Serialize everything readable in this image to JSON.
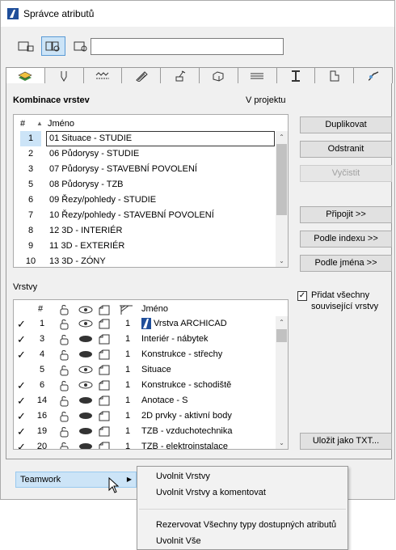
{
  "window": {
    "title": "Správce atributů"
  },
  "search": {
    "value": ""
  },
  "toolbar": {
    "buttons": [
      "view-list-icon",
      "view-split-icon",
      "view-detail-icon"
    ]
  },
  "tabs": [
    "layers-icon",
    "pen-icon",
    "line-type-icon",
    "fill-icon",
    "building-material-icon",
    "composite-icon",
    "surface-icon",
    "profile-icon",
    "zone-icon",
    "mep-icon"
  ],
  "combos": {
    "title": "Kombinace vrstev",
    "right_label": "V projektu",
    "col_num": "#",
    "col_name": "Jméno",
    "rows": [
      {
        "num": "1",
        "name": "01 Situace - STUDIE"
      },
      {
        "num": "2",
        "name": "06 Půdorysy - STUDIE"
      },
      {
        "num": "3",
        "name": "07 Půdorysy - STAVEBNÍ POVOLENÍ"
      },
      {
        "num": "5",
        "name": "08 Půdorysy - TZB"
      },
      {
        "num": "6",
        "name": "09 Řezy/pohledy - STUDIE"
      },
      {
        "num": "7",
        "name": "10 Řezy/pohledy - STAVEBNÍ POVOLENÍ"
      },
      {
        "num": "8",
        "name": "12 3D - INTERIÉR"
      },
      {
        "num": "9",
        "name": "11 3D - EXTERIÉR"
      },
      {
        "num": "10",
        "name": "13 3D - ZÓNY"
      }
    ]
  },
  "buttons": {
    "duplicate": "Duplikovat",
    "remove": "Odstranit",
    "clear": "Vyčistit",
    "append": "Připojit >>",
    "by_index": "Podle indexu >>",
    "by_name": "Podle jména >>",
    "save_txt": "Uložit jako TXT..."
  },
  "add_related": {
    "label": "Přidat všechny související vrstvy",
    "checked": true
  },
  "layers": {
    "title": "Vrstvy",
    "col_num": "#",
    "col_name": "Jméno",
    "rows": [
      {
        "check": "✓",
        "num": "1",
        "value": "1",
        "name": "Vrstva ARCHICAD",
        "visible": true
      },
      {
        "check": "✓",
        "num": "3",
        "value": "1",
        "name": "Interiér - nábytek",
        "visible": false
      },
      {
        "check": "✓",
        "num": "4",
        "value": "1",
        "name": "Konstrukce - střechy",
        "visible": false
      },
      {
        "check": "",
        "num": "5",
        "value": "1",
        "name": "Situace",
        "visible": true
      },
      {
        "check": "✓",
        "num": "6",
        "value": "1",
        "name": "Konstrukce - schodiště",
        "visible": true
      },
      {
        "check": "✓",
        "num": "14",
        "value": "1",
        "name": "Anotace - S",
        "visible": false
      },
      {
        "check": "✓",
        "num": "16",
        "value": "1",
        "name": "2D prvky - aktivní body",
        "visible": false
      },
      {
        "check": "✓",
        "num": "19",
        "value": "1",
        "name": "TZB - vzduchotechnika",
        "visible": false
      },
      {
        "check": "✓",
        "num": "20",
        "value": "1",
        "name": "TZB - elektroinstalace",
        "visible": false
      }
    ]
  },
  "teamwork": {
    "label": "Teamwork"
  },
  "menu": {
    "items": [
      "Uvolnit Vrstvy",
      "Uvolnit Vrstvy a komentovat",
      "Rezervovat Všechny typy dostupných atributů",
      "Uvolnit Vše"
    ]
  },
  "colors": {
    "selection": "#cce4f7",
    "accent": "#5a9ad5"
  }
}
